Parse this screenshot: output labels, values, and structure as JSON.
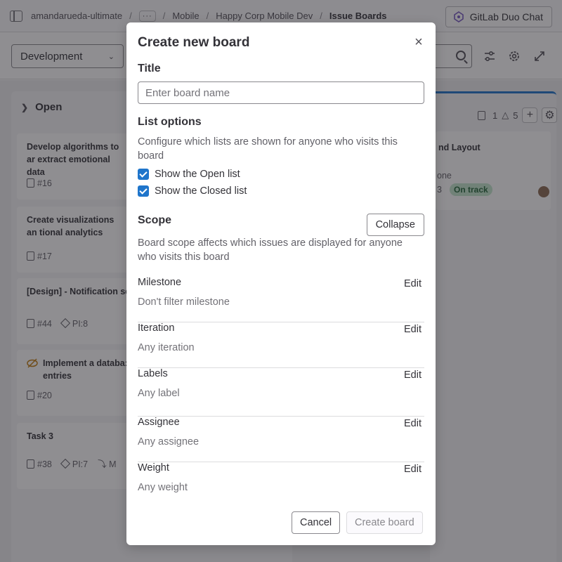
{
  "breadcrumb": {
    "items": [
      "amandarueda-ultimate",
      "Mobile",
      "Happy Corp Mobile Dev"
    ],
    "current": "Issue Boards",
    "more": "···"
  },
  "header": {
    "duo_chat_label": "GitLab Duo Chat"
  },
  "filterbar": {
    "board_selector": "Development"
  },
  "board": {
    "open_list": {
      "title": "Open",
      "cards": [
        {
          "title": "Develop algorithms to ar extract emotional data",
          "number": "#16"
        },
        {
          "title": "Create visualizations an tional analytics",
          "number": "#17"
        },
        {
          "title": "[Design] - Notification se",
          "number": "#44",
          "weight": "PI:8"
        },
        {
          "title": "Implement a databa: entries",
          "number": "#20"
        },
        {
          "title": "Task 3",
          "number": "#38",
          "weight": "PI:7",
          "extra": "M"
        }
      ]
    },
    "right_list": {
      "issue_count": "1",
      "weight_count": "5",
      "card_title": "nd Layout",
      "card_sub": "one",
      "card_num": "3",
      "status_badge": "On track"
    }
  },
  "modal": {
    "title": "Create new board",
    "title_section": {
      "label": "Title",
      "placeholder": "Enter board name"
    },
    "list_options": {
      "label": "List options",
      "help": "Configure which lists are shown for anyone who visits this board",
      "show_open": "Show the Open list",
      "show_closed": "Show the Closed list"
    },
    "scope": {
      "label": "Scope",
      "collapse_label": "Collapse",
      "help": "Board scope affects which issues are displayed for anyone who visits this board",
      "edit_label": "Edit",
      "rows": [
        {
          "label": "Milestone",
          "value": "Don't filter milestone"
        },
        {
          "label": "Iteration",
          "value": "Any iteration"
        },
        {
          "label": "Labels",
          "value": "Any label"
        },
        {
          "label": "Assignee",
          "value": "Any assignee"
        },
        {
          "label": "Weight",
          "value": "Any weight"
        }
      ]
    },
    "footer": {
      "cancel_label": "Cancel",
      "create_label": "Create board"
    }
  }
}
